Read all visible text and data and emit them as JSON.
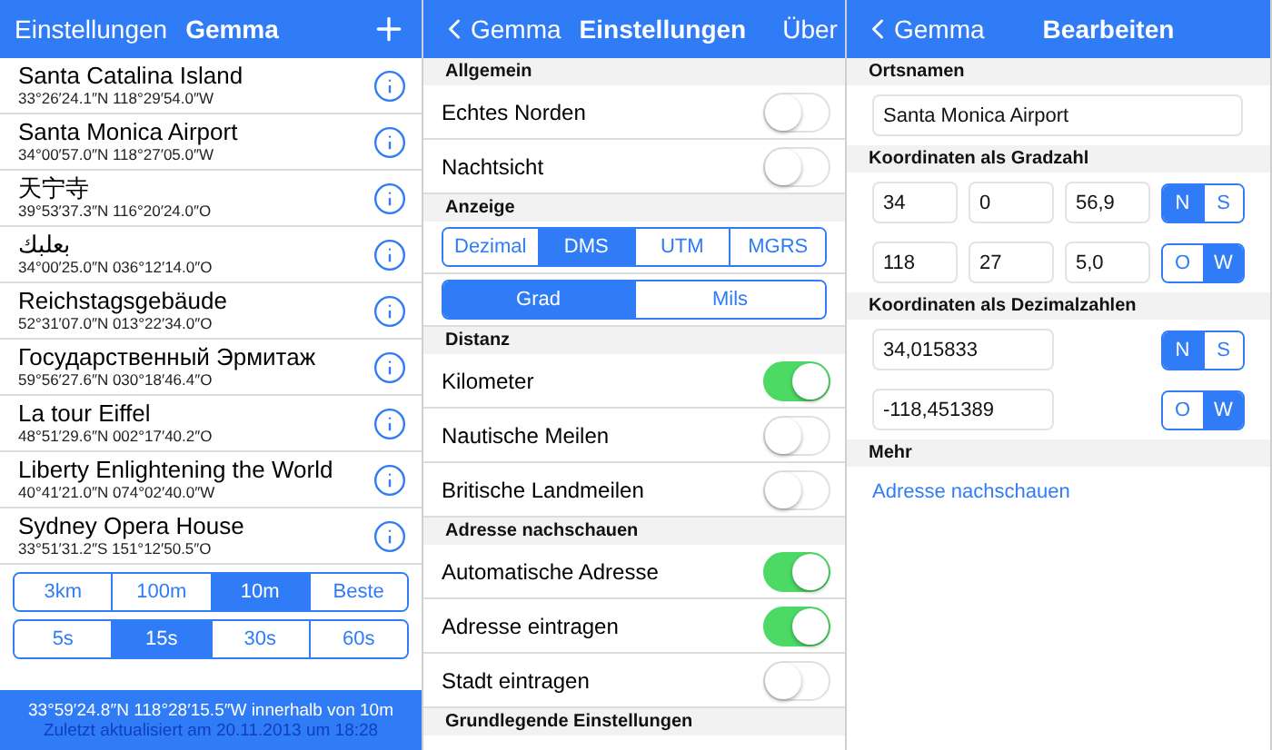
{
  "places_screen": {
    "nav": {
      "left": "Einstellungen",
      "title": "Gemma"
    },
    "places": [
      {
        "name": "Santa Catalina Island",
        "coords": "33°26′24.1″N 118°29′54.0″W"
      },
      {
        "name": "Santa Monica Airport",
        "coords": "34°00′57.0″N 118°27′05.0″W"
      },
      {
        "name": "天宁寺",
        "coords": "39°53′37.3″N 116°20′24.0″O"
      },
      {
        "name": "بعلبك",
        "coords": "34°00′25.0″N 036°12′14.0″O"
      },
      {
        "name": "Reichstagsgebäude",
        "coords": "52°31′07.0″N 013°22′34.0″O"
      },
      {
        "name": "Государственный Эрмитаж",
        "coords": "59°56′27.6″N 030°18′46.4″O"
      },
      {
        "name": "La tour Eiffel",
        "coords": "48°51′29.6″N 002°17′40.2″O"
      },
      {
        "name": "Liberty Enlightening the World",
        "coords": "40°41′21.0″N 074°02′40.0″W"
      },
      {
        "name": "Sydney Opera House",
        "coords": "33°51′31.2″S 151°12′50.5″O"
      }
    ],
    "segments": [
      {
        "options": [
          {
            "label": "3km",
            "selected": false
          },
          {
            "label": "100m",
            "selected": false
          },
          {
            "label": "10m",
            "selected": true
          },
          {
            "label": "Beste",
            "selected": false
          }
        ]
      },
      {
        "options": [
          {
            "label": "5s",
            "selected": false
          },
          {
            "label": "15s",
            "selected": true
          },
          {
            "label": "30s",
            "selected": false
          },
          {
            "label": "60s",
            "selected": false
          }
        ]
      }
    ],
    "footer": {
      "position": "33°59′24.8″N 118°28′15.5″W innerhalb von 10m",
      "updated": "Zuletzt aktualisiert am 20.11.2013 um 18:28"
    }
  },
  "settings_screen": {
    "nav": {
      "back": "Gemma",
      "title": "Einstellungen",
      "right": "Über"
    },
    "sections": [
      {
        "header": "Allgemein",
        "items": [
          {
            "kind": "toggle",
            "label": "Echtes Norden",
            "on": false
          },
          {
            "kind": "toggle",
            "label": "Nachtsicht",
            "on": false
          }
        ]
      },
      {
        "header": "Anzeige",
        "items": [
          {
            "kind": "segment",
            "options": [
              {
                "label": "Dezimal",
                "selected": false
              },
              {
                "label": "DMS",
                "selected": true
              },
              {
                "label": "UTM",
                "selected": false
              },
              {
                "label": "MGRS",
                "selected": false
              }
            ]
          },
          {
            "kind": "segment",
            "options": [
              {
                "label": "Grad",
                "selected": true
              },
              {
                "label": "Mils",
                "selected": false
              }
            ]
          }
        ]
      },
      {
        "header": "Distanz",
        "items": [
          {
            "kind": "toggle",
            "label": "Kilometer",
            "on": true
          },
          {
            "kind": "toggle",
            "label": "Nautische Meilen",
            "on": false
          },
          {
            "kind": "toggle",
            "label": "Britische Landmeilen",
            "on": false
          }
        ]
      },
      {
        "header": "Adresse nachschauen",
        "items": [
          {
            "kind": "toggle",
            "label": "Automatische Adresse",
            "on": true
          },
          {
            "kind": "toggle",
            "label": "Adresse eintragen",
            "on": true
          },
          {
            "kind": "toggle",
            "label": "Stadt eintragen",
            "on": false
          }
        ]
      },
      {
        "header": "Grundlegende Einstellungen"
      }
    ]
  },
  "edit_screen": {
    "nav": {
      "back": "Gemma",
      "title": "Bearbeiten"
    },
    "name_header": "Ortsnamen",
    "name_value": "Santa Monica Airport",
    "degrees_header": "Koordinaten als Gradzahl",
    "degree_rows": [
      {
        "fields": [
          "34",
          "0",
          "56,9"
        ],
        "options": [
          {
            "label": "N",
            "selected": true
          },
          {
            "label": "S",
            "selected": false
          }
        ]
      },
      {
        "fields": [
          "118",
          "27",
          "5,0"
        ],
        "options": [
          {
            "label": "O",
            "selected": false
          },
          {
            "label": "W",
            "selected": true
          }
        ]
      }
    ],
    "decimal_header": "Koordinaten als Dezimalzahlen",
    "decimal_rows": [
      {
        "value": "34,015833",
        "options": [
          {
            "label": "N",
            "selected": true
          },
          {
            "label": "S",
            "selected": false
          }
        ]
      },
      {
        "value": "-118,451389",
        "options": [
          {
            "label": "O",
            "selected": false
          },
          {
            "label": "W",
            "selected": true
          }
        ]
      }
    ],
    "more_header": "Mehr",
    "link": "Adresse nachschauen"
  }
}
